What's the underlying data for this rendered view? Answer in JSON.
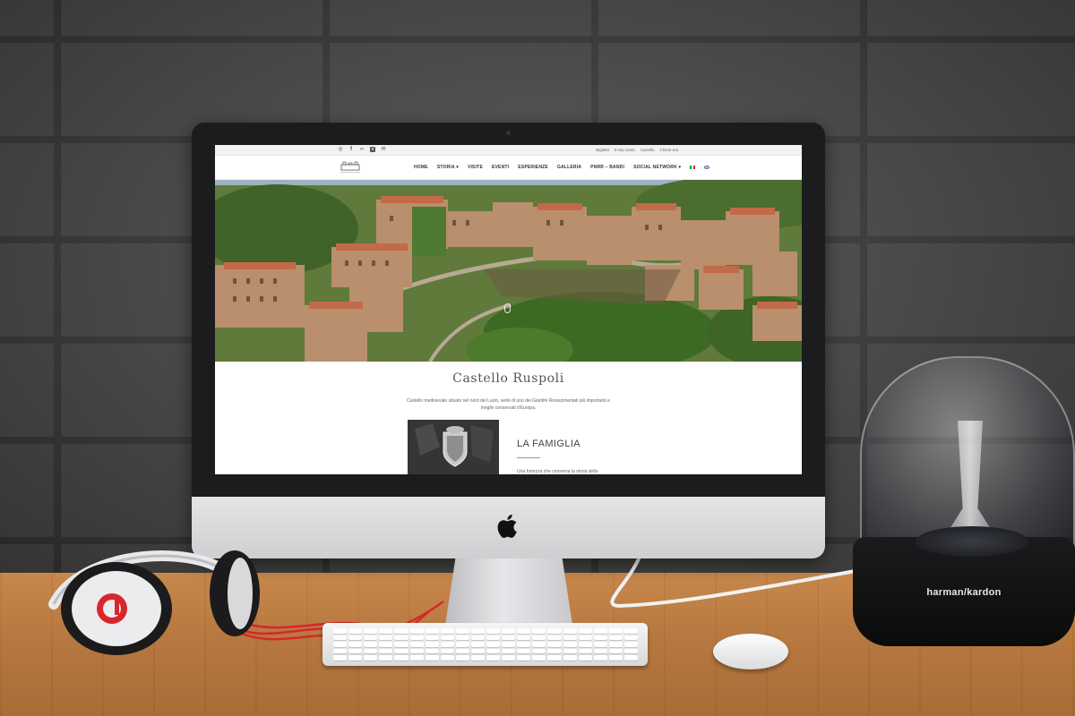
{
  "website": {
    "topbar": {
      "social_icons": [
        "instagram-icon",
        "facebook-icon",
        "tripadvisor-icon",
        "vimeo-icon",
        "email-icon"
      ],
      "links": [
        "Biglietti",
        "Il mio conto",
        "Carrello",
        "Check-out"
      ]
    },
    "nav": {
      "items": [
        "HOME",
        "STORIA ▾",
        "VISITE",
        "EVENTI",
        "ESPERIENZE",
        "GALLERIA",
        "PNRR – BANDI",
        "SOCIAL NETWORK ▾"
      ],
      "languages": [
        "it-flag-icon",
        "en-flag-icon"
      ]
    },
    "main": {
      "title": "Castello Ruspoli",
      "subtitle": "Castello medioevale situato nel nord del Lazio, sede di uno dei Giardini Rinascimentali più importanti e meglio conservati d'Europa.",
      "section_title": "LA FAMIGLIA",
      "section_text": "Una fortezza che conserva la storia della"
    }
  },
  "speaker_brand": "harman/kardon",
  "colors": {
    "wall": "#505050",
    "desk": "#b97a41",
    "imac_bezel": "#1c1c1e",
    "headphone_red": "#d8262a"
  }
}
